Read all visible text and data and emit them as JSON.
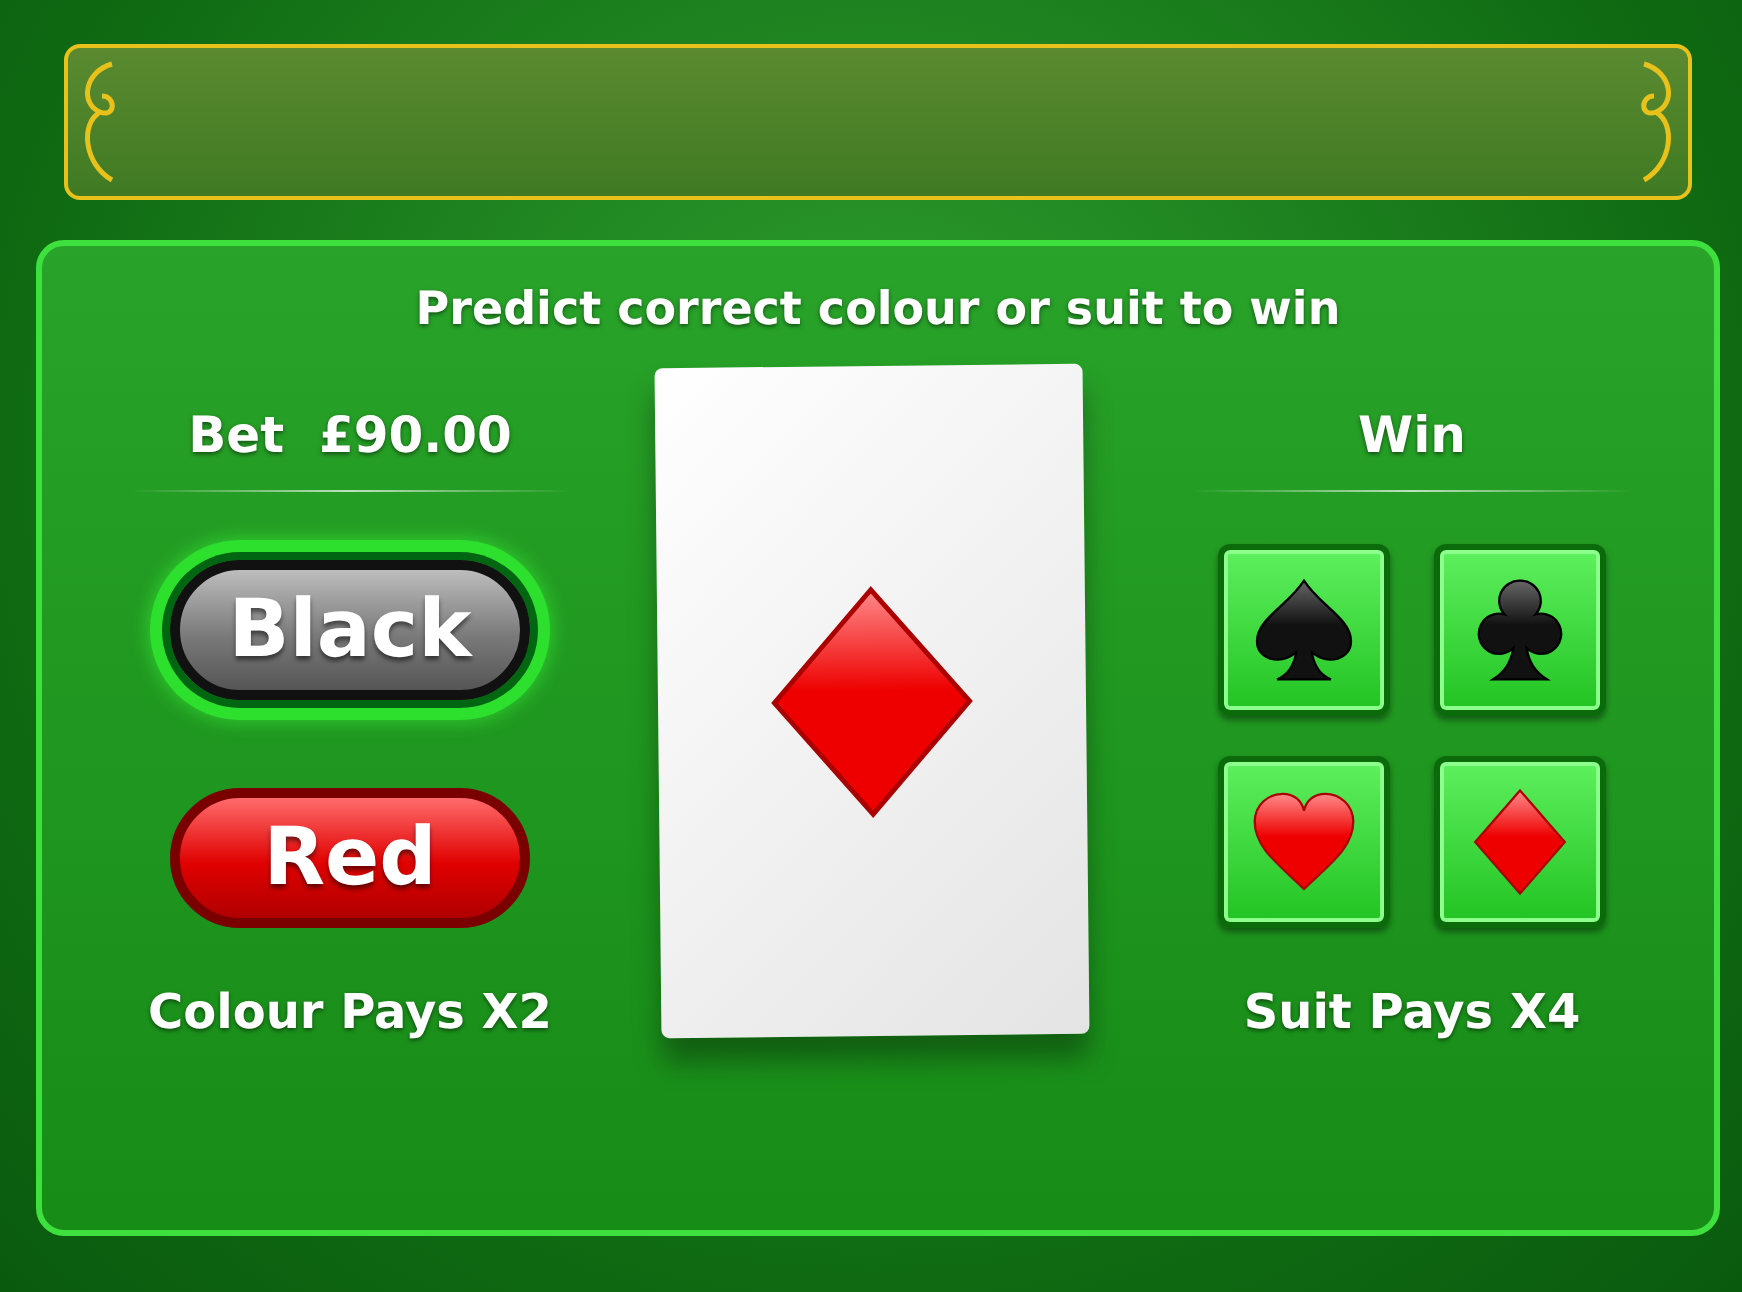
{
  "instruction": "Predict correct colour or suit to win",
  "bet": {
    "label": "Bet",
    "amount": "£90.00"
  },
  "colour_buttons": [
    {
      "label": "Black",
      "kind": "black",
      "selected": true
    },
    {
      "label": "Red",
      "kind": "red",
      "selected": false
    }
  ],
  "colour_pays": "Colour Pays X2",
  "card": {
    "kind": "diamond"
  },
  "win_label": "Win",
  "suit_buttons": [
    {
      "kind": "spade"
    },
    {
      "kind": "club"
    },
    {
      "kind": "heart"
    },
    {
      "kind": "diamond"
    }
  ],
  "suit_pays": "Suit Pays X4"
}
